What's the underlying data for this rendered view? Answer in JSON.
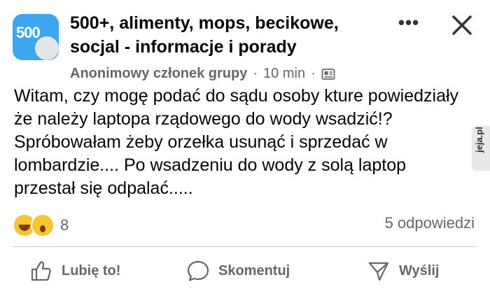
{
  "post": {
    "group_name": "500+, alimenty, mops, becikowe, socjal - informacje i porady",
    "avatar_text": "500",
    "author": "Anonimowy członek grupy",
    "separator": "·",
    "time": "10 min",
    "separator2": "·",
    "body": "Witam, czy mogę podać do sądu osoby kture powiedziały że należy laptopa rządowego do wody wsadzić!? Spróbowałam żeby orzełka usunąć i sprzedać w lombardzie.... Po wsadzeniu do wody z solą laptop przestał się odpalać....."
  },
  "header": {
    "more_label": "•••"
  },
  "stats": {
    "reaction_count": "8",
    "comment_count": "5 odpowiedzi"
  },
  "actions": {
    "like": "Lubię to!",
    "comment": "Skomentuj",
    "share": "Wyślij"
  },
  "watermark": "jeja.pl",
  "colors": {
    "text": "#050505",
    "secondary": "#65676b",
    "avatar_bg": "#3ea6ee",
    "reaction_yellow": "#f7c531"
  },
  "icons": {
    "more": "more-icon",
    "close": "close-icon",
    "privacy": "privacy-icon",
    "like": "thumbs-up-icon",
    "comment": "comment-bubble-icon",
    "share": "send-icon"
  }
}
